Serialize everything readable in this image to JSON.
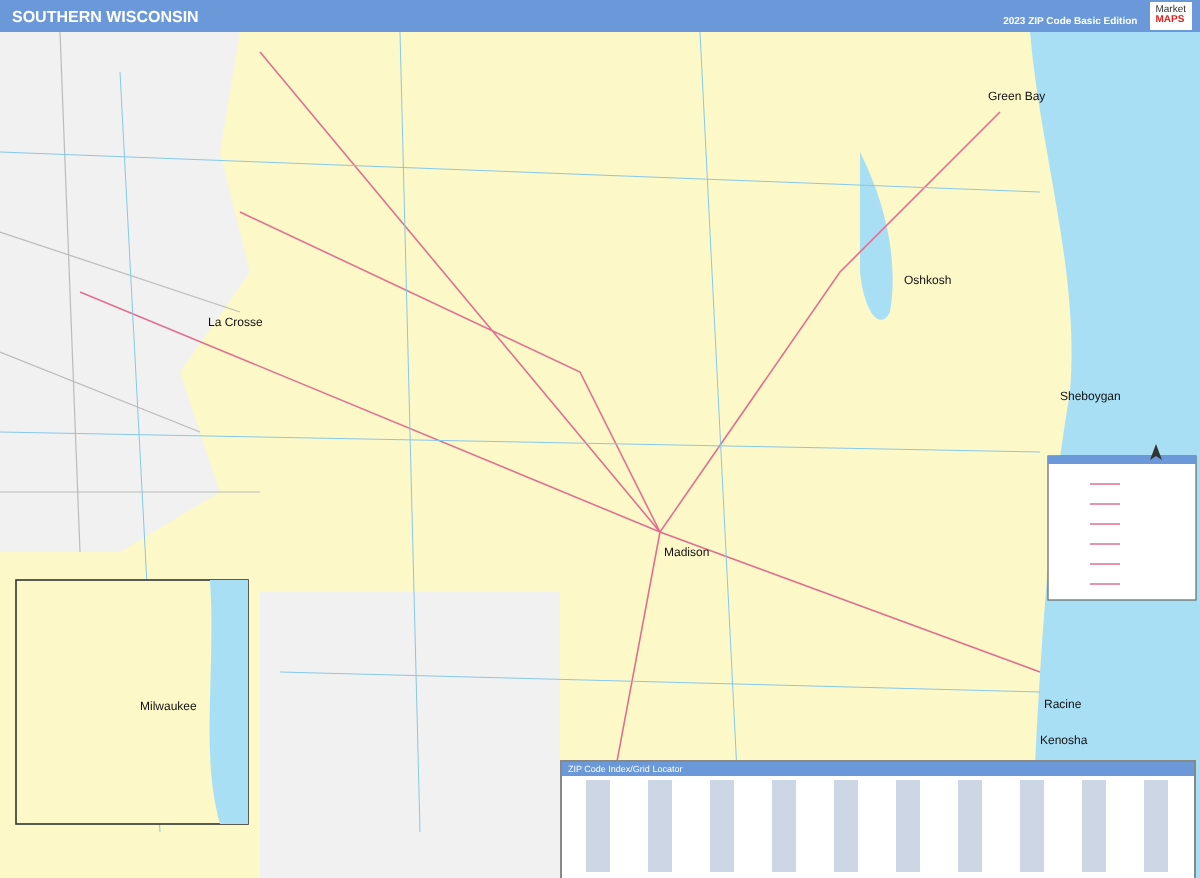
{
  "header": {
    "title": "SOUTHERN WISCONSIN",
    "edition": "2023 ZIP Code Basic Edition",
    "logo": {
      "line_1": "Market",
      "line_2": "MAPS"
    }
  },
  "cities": [
    "Green Bay",
    "Oshkosh",
    "La Crosse",
    "Sheboygan",
    "Madison",
    "Racine",
    "Kenosha",
    "Milwaukee"
  ],
  "index": {
    "title": "ZIP Code Index/Grid Locator"
  }
}
